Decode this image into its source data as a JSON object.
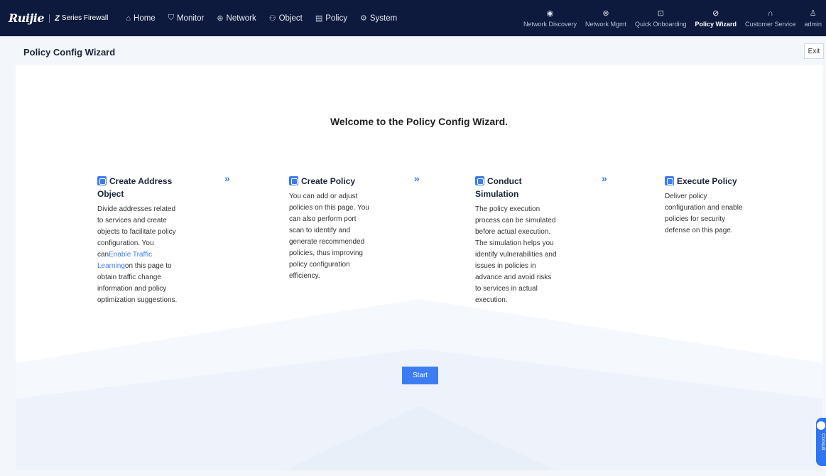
{
  "brand": {
    "logo": "Ruijie",
    "series_mark": "Z",
    "series_text": "Series Firewall"
  },
  "menu": [
    {
      "icon": "home-icon",
      "glyph": "⌂",
      "label": "Home"
    },
    {
      "icon": "shield-icon",
      "glyph": "⛉",
      "label": "Monitor"
    },
    {
      "icon": "globe-icon",
      "glyph": "⊕",
      "label": "Network"
    },
    {
      "icon": "user-group-icon",
      "glyph": "⚇",
      "label": "Object"
    },
    {
      "icon": "policy-icon",
      "glyph": "▤",
      "label": "Policy"
    },
    {
      "icon": "gear-icon",
      "glyph": "⚙",
      "label": "System"
    }
  ],
  "tools": [
    {
      "icon": "radar-icon",
      "glyph": "◉",
      "label": "Network Discovery"
    },
    {
      "icon": "network-mgmt-icon",
      "glyph": "⊗",
      "label": "Network Mgmt"
    },
    {
      "icon": "onboarding-icon",
      "glyph": "⊡",
      "label": "Quick Onboarding"
    },
    {
      "icon": "compass-icon",
      "glyph": "⊘",
      "label": "Policy Wizard"
    },
    {
      "icon": "headset-icon",
      "glyph": "∩",
      "label": "Customer Service"
    },
    {
      "icon": "user-icon",
      "glyph": "♙",
      "label": "admin"
    }
  ],
  "page": {
    "title": "Policy Config Wizard",
    "exit_label": "Exit"
  },
  "wizard": {
    "welcome": "Welcome to the Policy Config Wizard.",
    "steps": [
      {
        "title": "Create Address Object",
        "desc_before": "Divide addresses related to services and create objects to facilitate policy configuration. You can",
        "link": "Enable Traffic Learning",
        "desc_after": "on this page to obtain traffic change information and policy optimization suggestions."
      },
      {
        "title": "Create Policy",
        "desc": "You can add or adjust policies on this page. You can also perform port scan to identify and generate recommended policies, thus improving policy configuration efficiency."
      },
      {
        "title": "Conduct Simulation",
        "desc": "The policy execution process can be simulated before actual execution. The simulation helps you identify vulnerabilities and issues in policies in advance and avoid risks to services in actual execution."
      },
      {
        "title": "Execute Policy",
        "desc": "Deliver policy configuration and enable policies for security defense on this page."
      }
    ],
    "arrow": "»",
    "start_label": "Start"
  },
  "consult": {
    "label": "Consult"
  },
  "colors": {
    "nav_bg": "#0d1a3d",
    "accent": "#3d7cf3"
  }
}
